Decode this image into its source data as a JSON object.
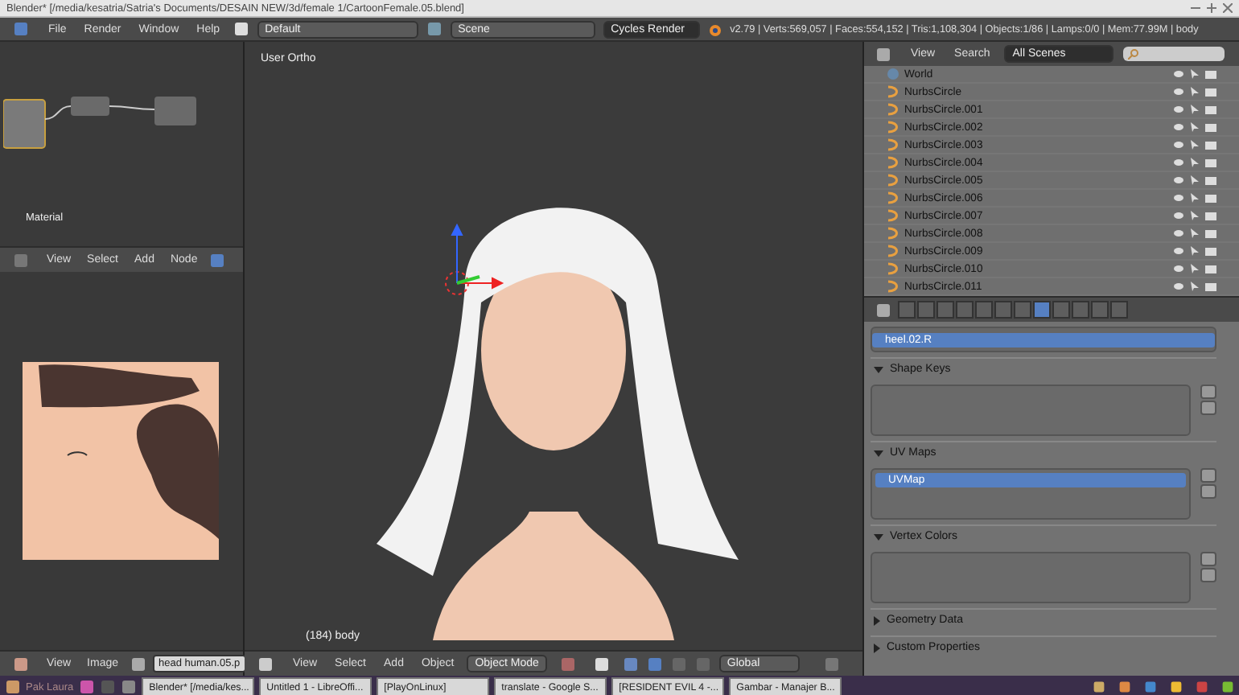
{
  "window": {
    "title": "Blender* [/media/kesatria/Satria's Documents/DESAIN NEW/3d/female 1/CartoonFemale.05.blend]"
  },
  "info_header": {
    "menus": [
      "File",
      "Render",
      "Window",
      "Help"
    ],
    "layout": "Default",
    "scene": "Scene",
    "engine": "Cycles Render",
    "stats": "v2.79 | Verts:569,057 | Faces:554,152 | Tris:1,108,304 | Objects:1/86 | Lamps:0/0 | Mem:77.99M | body"
  },
  "node_editor": {
    "label": "Material",
    "menus": [
      "View",
      "Select",
      "Add",
      "Node"
    ]
  },
  "image_editor": {
    "menus": [
      "View",
      "Image"
    ],
    "image_name": "head human.05.p"
  },
  "viewport": {
    "view_label": "User Ortho",
    "object_label": "(184) body",
    "menus": [
      "View",
      "Select",
      "Add",
      "Object"
    ],
    "mode": "Object Mode",
    "orientation": "Global"
  },
  "outliner": {
    "menus": [
      "View",
      "Search"
    ],
    "filter": "All Scenes",
    "items": [
      {
        "name": "World",
        "kind": "world"
      },
      {
        "name": "NurbsCircle",
        "kind": "curve"
      },
      {
        "name": "NurbsCircle.001",
        "kind": "curve"
      },
      {
        "name": "NurbsCircle.002",
        "kind": "curve"
      },
      {
        "name": "NurbsCircle.003",
        "kind": "curve"
      },
      {
        "name": "NurbsCircle.004",
        "kind": "curve"
      },
      {
        "name": "NurbsCircle.005",
        "kind": "curve"
      },
      {
        "name": "NurbsCircle.006",
        "kind": "curve"
      },
      {
        "name": "NurbsCircle.007",
        "kind": "curve"
      },
      {
        "name": "NurbsCircle.008",
        "kind": "curve"
      },
      {
        "name": "NurbsCircle.009",
        "kind": "curve"
      },
      {
        "name": "NurbsCircle.010",
        "kind": "curve"
      },
      {
        "name": "NurbsCircle.011",
        "kind": "curve"
      }
    ]
  },
  "properties": {
    "tabs": [
      {
        "selected": false
      },
      {
        "selected": false
      },
      {
        "selected": false
      },
      {
        "selected": false
      },
      {
        "selected": false
      },
      {
        "selected": false
      },
      {
        "selected": false
      },
      {
        "selected": true
      },
      {
        "selected": false
      },
      {
        "selected": false
      },
      {
        "selected": false
      },
      {
        "selected": false
      }
    ],
    "vertex_group": "heel.02.R",
    "panels": [
      {
        "title": "Shape Keys",
        "expanded": true
      },
      {
        "title": "UV Maps",
        "expanded": true,
        "items": [
          "UVMap"
        ]
      },
      {
        "title": "Vertex Colors",
        "expanded": true
      },
      {
        "title": "Geometry Data",
        "expanded": false
      },
      {
        "title": "Custom Properties",
        "expanded": false
      }
    ]
  },
  "taskbar": {
    "user": "Pak Laura",
    "tasks": [
      "Blender* [/media/kes...",
      "Untitled 1 - LibreOffi...",
      "[PlayOnLinux]",
      "translate - Google S...",
      "[RESIDENT EVIL 4 -...",
      "Gambar - Manajer B..."
    ]
  }
}
